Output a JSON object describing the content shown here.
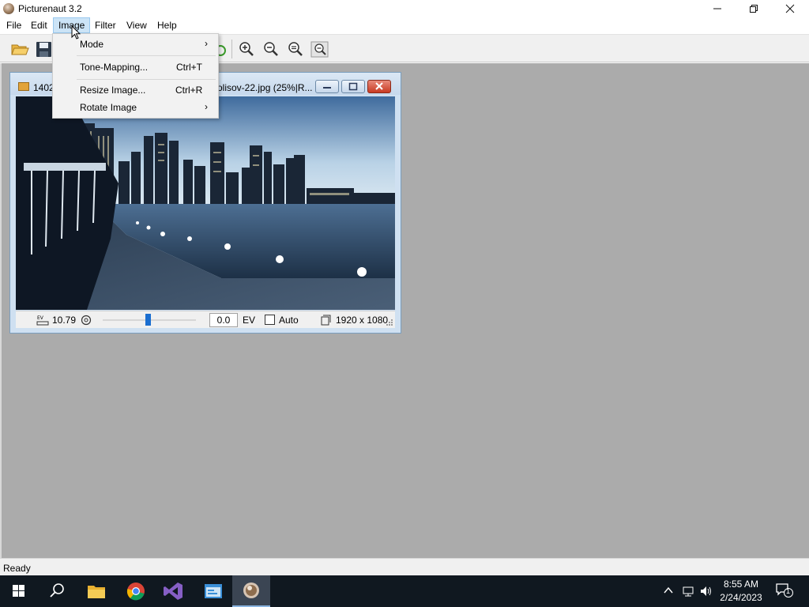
{
  "window": {
    "title": "Picturenaut 3.2"
  },
  "menubar": {
    "items": [
      "File",
      "Edit",
      "Image",
      "Filter",
      "View",
      "Help"
    ],
    "active": "Image"
  },
  "image_menu": {
    "items": [
      {
        "label": "Mode",
        "shortcut": "",
        "submenu": true
      },
      {
        "label": "Tone-Mapping...",
        "shortcut": "Ctrl+T",
        "submenu": false
      },
      {
        "label": "Resize Image...",
        "shortcut": "Ctrl+R",
        "submenu": false
      },
      {
        "label": "Rotate Image",
        "shortcut": "",
        "submenu": true
      }
    ]
  },
  "document": {
    "title_left": "1402",
    "title_right": "olisov-22.jpg (25%|R...",
    "exposure_value": "10.79",
    "ev_input": "0.0",
    "ev_label": "EV",
    "auto_label": "Auto",
    "auto_checked": false,
    "dimensions": "1920 x 1080",
    "ev_slider_fraction": 0.5
  },
  "statusbar": {
    "text": "Ready"
  },
  "taskbar": {
    "time": "8:55 AM",
    "date": "2/24/2023",
    "notifications": "1"
  },
  "colors": {
    "menu_highlight": "#cce4f7",
    "workspace": "#ababab",
    "taskbar": "#101820",
    "accent": "#1a6ed0"
  }
}
